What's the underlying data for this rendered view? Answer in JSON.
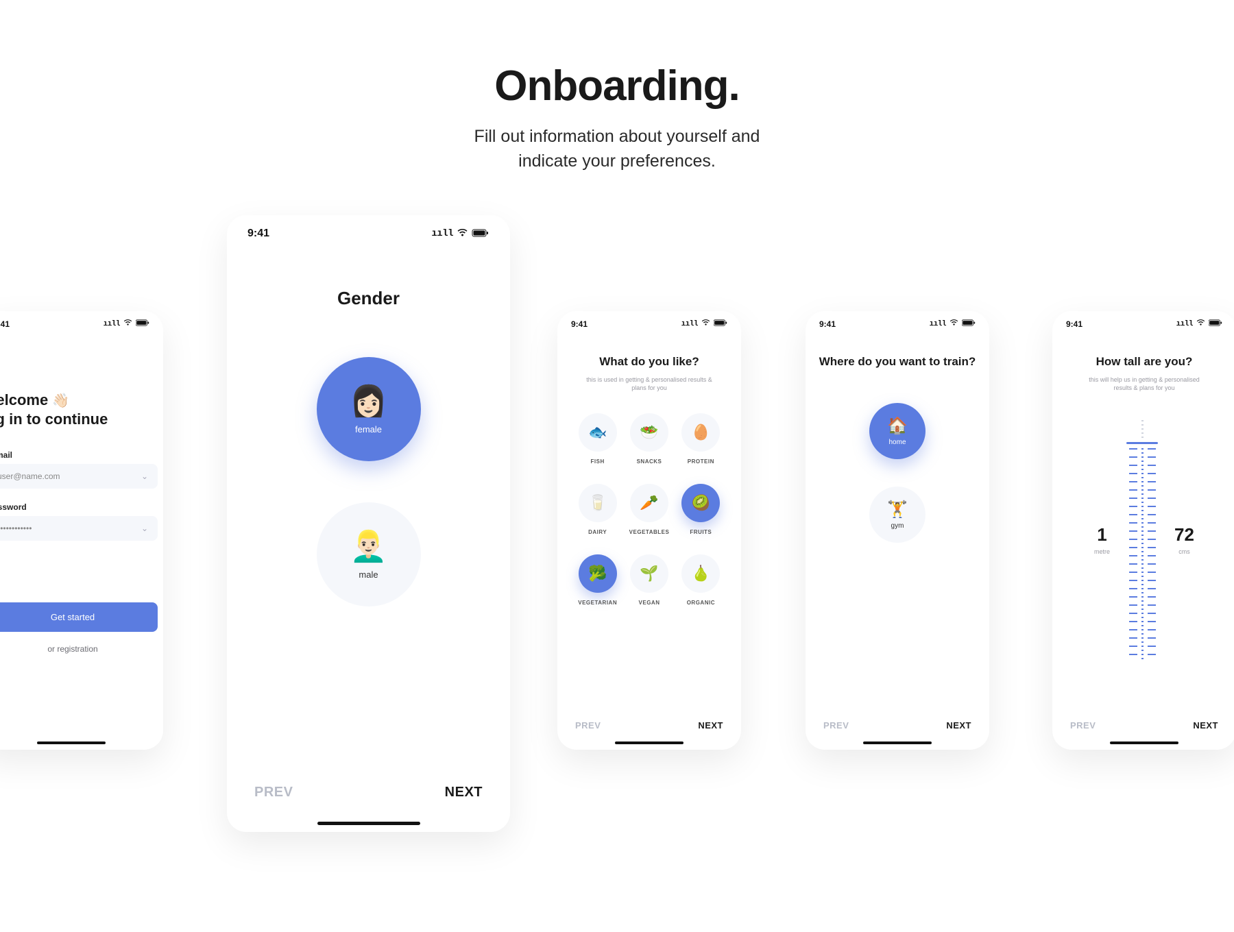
{
  "header": {
    "title": "Onboarding.",
    "subtitle_line1": "Fill out information about yourself and",
    "subtitle_line2": "indicate your preferences."
  },
  "common": {
    "time": "9:41",
    "prev": "PREV",
    "next": "NEXT"
  },
  "login": {
    "welcome_line1": "Welcome",
    "wave_emoji": "👋🏻",
    "welcome_line2": "log in to continue",
    "email_label": "E-mail",
    "email_placeholder": "user@name.com",
    "password_label": "Password",
    "password_placeholder": "••••••••••••",
    "get_started": "Get started",
    "or_registration": "or registration"
  },
  "gender": {
    "title": "Gender",
    "options": {
      "female": {
        "emoji": "👩🏻",
        "label": "female",
        "selected": true
      },
      "male": {
        "emoji": "👱🏻‍♂️",
        "label": "male",
        "selected": false
      }
    }
  },
  "likes": {
    "title": "What do you like?",
    "subtitle": "this is used in getting & personalised results & plans for you",
    "items": [
      {
        "emoji": "🐟",
        "label": "FISH",
        "selected": false
      },
      {
        "emoji": "🥗",
        "label": "SNACKS",
        "selected": false
      },
      {
        "emoji": "🥚",
        "label": "PROTEIN",
        "selected": false
      },
      {
        "emoji": "🥛",
        "label": "DAIRY",
        "selected": false
      },
      {
        "emoji": "🥕",
        "label": "VEGETABLES",
        "selected": false
      },
      {
        "emoji": "🥝",
        "label": "FRUITS",
        "selected": true
      },
      {
        "emoji": "🥦",
        "label": "VEGETARIAN",
        "selected": true
      },
      {
        "emoji": "🌱",
        "label": "VEGAN",
        "selected": false
      },
      {
        "emoji": "🍐",
        "label": "ORGANIC",
        "selected": false
      }
    ]
  },
  "train": {
    "title": "Where do you want to train?",
    "options": {
      "home": {
        "emoji": "🏠",
        "label": "home",
        "selected": true
      },
      "gym": {
        "emoji": "🏋️",
        "label": "gym",
        "selected": false
      }
    }
  },
  "height": {
    "title": "How tall are you?",
    "subtitle": "this will help us in getting & personalised results & plans for you",
    "metre_value": "1",
    "metre_label": "metre",
    "cms_value": "72",
    "cms_label": "cms"
  }
}
